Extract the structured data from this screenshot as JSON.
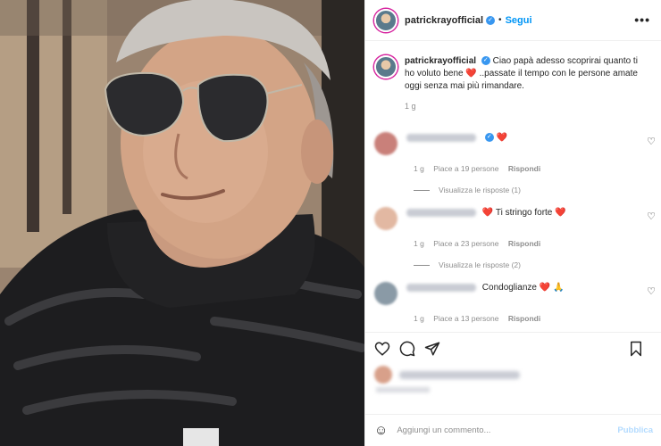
{
  "post": {
    "username": "patrickrayofficial",
    "follow_label": "Segui",
    "more_icon": "more-dots-icon",
    "caption_text": "Ciao papà adesso scoprirai quanto ti ho voluto bene ❤️ ..passate il tempo con le persone amate oggi senza mai più rimandare.",
    "caption_time": "1 g"
  },
  "comments": [
    {
      "text": "❤️",
      "time": "1 g",
      "likes": "Piace a 19 persone",
      "reply_label": "Rispondi",
      "view_replies": "Visualizza le risposte (1)",
      "avatar_color": "#c9807a"
    },
    {
      "text": "❤️ Ti stringo forte ❤️",
      "time": "1 g",
      "likes": "Piace a 23 persone",
      "reply_label": "Rispondi",
      "view_replies": "Visualizza le risposte (2)",
      "avatar_color": "#e2b8a2"
    },
    {
      "text": "Condoglianze ❤️ 🙏",
      "time": "1 g",
      "likes": "Piace a 13 persone",
      "reply_label": "Rispondi",
      "avatar_color": "#8a9aa6"
    }
  ],
  "actions": {
    "icons": [
      "heart-icon",
      "comment-icon",
      "share-icon",
      "bookmark-icon"
    ]
  },
  "add_comment": {
    "placeholder": "Aggiungi un commento...",
    "publish_label": "Pubblica"
  },
  "colors": {
    "accent": "#0095f6",
    "publish_disabled": "#b3dbff",
    "heart": "#ed1c24",
    "muted": "#8e8e8e"
  }
}
